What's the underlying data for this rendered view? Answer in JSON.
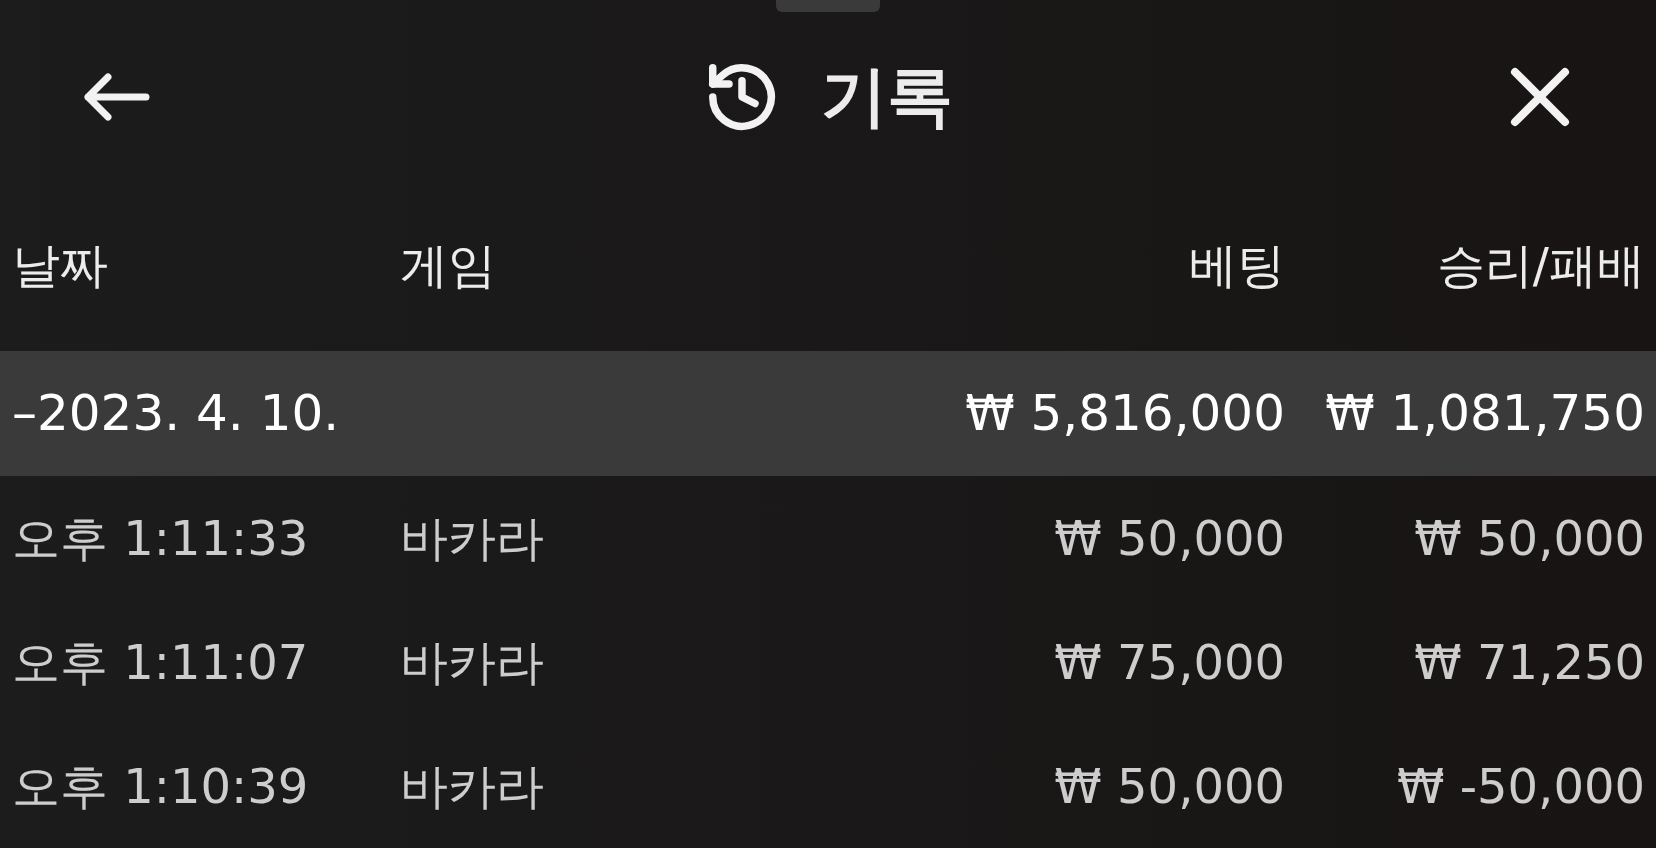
{
  "header": {
    "title": "기록"
  },
  "table": {
    "columns": [
      "날짜",
      "게임",
      "베팅",
      "승리/패배"
    ],
    "summary": {
      "date": "–2023. 4. 10.",
      "bet": "₩ 5,816,000",
      "result": "₩ 1,081,750"
    },
    "rows": [
      {
        "time": "오후 1:11:33",
        "game": "바카라",
        "bet": "₩ 50,000",
        "result": "₩ 50,000"
      },
      {
        "time": "오후 1:11:07",
        "game": "바카라",
        "bet": "₩ 75,000",
        "result": "₩ 71,250"
      },
      {
        "time": "오후 1:10:39",
        "game": "바카라",
        "bet": "₩ 50,000",
        "result": "₩ -50,000"
      }
    ]
  }
}
